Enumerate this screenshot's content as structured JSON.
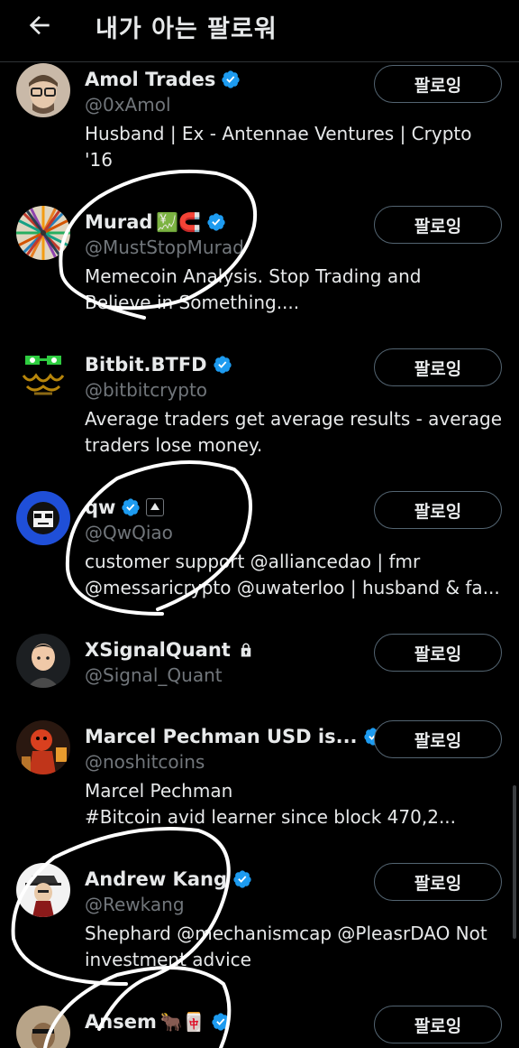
{
  "header": {
    "back_icon": "arrow-left-icon",
    "title": "내가 아는 팔로워"
  },
  "colors": {
    "verified": "#1d9bf0",
    "background": "#000000",
    "muted": "#71767b"
  },
  "users": [
    {
      "name": "Amol Trades",
      "emoji": "",
      "verified": true,
      "handle": "@0xAmol",
      "bio": [
        "Husband | Ex - Antennae Ventures | Crypto",
        "'16"
      ],
      "button": "팔로잉"
    },
    {
      "name": "Murad",
      "emoji": "💹🧲",
      "verified": true,
      "handle": "@MustStopMurad",
      "bio": [
        "Memecoin Analysis. Stop Trading and",
        "Believe in Something...."
      ],
      "button": "팔로잉"
    },
    {
      "name": "Bitbit.BTFD",
      "emoji": "",
      "verified": true,
      "handle": "@bitbitcrypto",
      "bio": [
        "Average traders get average results - average",
        "traders lose money."
      ],
      "button": "팔로잉"
    },
    {
      "name": "qw",
      "emoji": "",
      "verified": true,
      "handle": "@QwQiao",
      "bio": [
        "customer support @alliancedao | fmr",
        "@messaricrypto @uwaterloo | husband & fa..."
      ],
      "button": "팔로잉"
    },
    {
      "name": "XSignalQuant",
      "emoji": "",
      "verified": false,
      "handle": "@Signal_Quant",
      "bio": [],
      "button": "팔로잉"
    },
    {
      "name": "Marcel Pechman USD is...",
      "emoji": "",
      "verified": true,
      "handle": "@noshitcoins",
      "bio": [
        "Marcel Pechman",
        "#Bitcoin avid learner since block 470,2..."
      ],
      "button": "팔로잉"
    },
    {
      "name": "Andrew Kang",
      "emoji": "",
      "verified": true,
      "handle": "@Rewkang",
      "bio": [
        "Shephard @mechanismcap @PleasrDAO Not",
        "investment advice"
      ],
      "button": "팔로잉"
    },
    {
      "name": "Ansem",
      "emoji": "🐂🀄",
      "verified": true,
      "handle": "",
      "bio": [],
      "button": "팔로잉"
    }
  ]
}
